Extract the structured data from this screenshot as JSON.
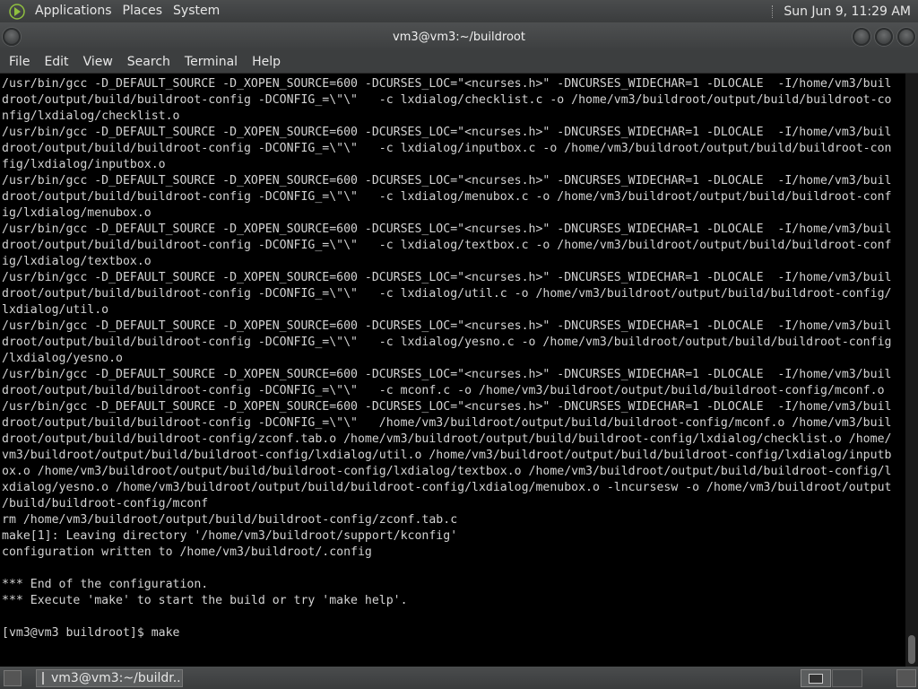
{
  "top_panel": {
    "menus": [
      "Applications",
      "Places",
      "System"
    ],
    "clock": "Sun Jun  9, 11:29 AM"
  },
  "window": {
    "title": "vm3@vm3:~/buildroot",
    "menu": [
      "File",
      "Edit",
      "View",
      "Search",
      "Terminal",
      "Help"
    ]
  },
  "terminal": {
    "lines": [
      "/usr/bin/gcc -D_DEFAULT_SOURCE -D_XOPEN_SOURCE=600 -DCURSES_LOC=\"<ncurses.h>\" -DNCURSES_WIDECHAR=1 -DLOCALE  -I/home/vm3/buil",
      "droot/output/build/buildroot-config -DCONFIG_=\\\"\\\"   -c lxdialog/checklist.c -o /home/vm3/buildroot/output/build/buildroot-co",
      "nfig/lxdialog/checklist.o",
      "/usr/bin/gcc -D_DEFAULT_SOURCE -D_XOPEN_SOURCE=600 -DCURSES_LOC=\"<ncurses.h>\" -DNCURSES_WIDECHAR=1 -DLOCALE  -I/home/vm3/buil",
      "droot/output/build/buildroot-config -DCONFIG_=\\\"\\\"   -c lxdialog/inputbox.c -o /home/vm3/buildroot/output/build/buildroot-con",
      "fig/lxdialog/inputbox.o",
      "/usr/bin/gcc -D_DEFAULT_SOURCE -D_XOPEN_SOURCE=600 -DCURSES_LOC=\"<ncurses.h>\" -DNCURSES_WIDECHAR=1 -DLOCALE  -I/home/vm3/buil",
      "droot/output/build/buildroot-config -DCONFIG_=\\\"\\\"   -c lxdialog/menubox.c -o /home/vm3/buildroot/output/build/buildroot-conf",
      "ig/lxdialog/menubox.o",
      "/usr/bin/gcc -D_DEFAULT_SOURCE -D_XOPEN_SOURCE=600 -DCURSES_LOC=\"<ncurses.h>\" -DNCURSES_WIDECHAR=1 -DLOCALE  -I/home/vm3/buil",
      "droot/output/build/buildroot-config -DCONFIG_=\\\"\\\"   -c lxdialog/textbox.c -o /home/vm3/buildroot/output/build/buildroot-conf",
      "ig/lxdialog/textbox.o",
      "/usr/bin/gcc -D_DEFAULT_SOURCE -D_XOPEN_SOURCE=600 -DCURSES_LOC=\"<ncurses.h>\" -DNCURSES_WIDECHAR=1 -DLOCALE  -I/home/vm3/buil",
      "droot/output/build/buildroot-config -DCONFIG_=\\\"\\\"   -c lxdialog/util.c -o /home/vm3/buildroot/output/build/buildroot-config/",
      "lxdialog/util.o",
      "/usr/bin/gcc -D_DEFAULT_SOURCE -D_XOPEN_SOURCE=600 -DCURSES_LOC=\"<ncurses.h>\" -DNCURSES_WIDECHAR=1 -DLOCALE  -I/home/vm3/buil",
      "droot/output/build/buildroot-config -DCONFIG_=\\\"\\\"   -c lxdialog/yesno.c -o /home/vm3/buildroot/output/build/buildroot-config",
      "/lxdialog/yesno.o",
      "/usr/bin/gcc -D_DEFAULT_SOURCE -D_XOPEN_SOURCE=600 -DCURSES_LOC=\"<ncurses.h>\" -DNCURSES_WIDECHAR=1 -DLOCALE  -I/home/vm3/buil",
      "droot/output/build/buildroot-config -DCONFIG_=\\\"\\\"   -c mconf.c -o /home/vm3/buildroot/output/build/buildroot-config/mconf.o",
      "/usr/bin/gcc -D_DEFAULT_SOURCE -D_XOPEN_SOURCE=600 -DCURSES_LOC=\"<ncurses.h>\" -DNCURSES_WIDECHAR=1 -DLOCALE  -I/home/vm3/buil",
      "droot/output/build/buildroot-config -DCONFIG_=\\\"\\\"   /home/vm3/buildroot/output/build/buildroot-config/mconf.o /home/vm3/buil",
      "droot/output/build/buildroot-config/zconf.tab.o /home/vm3/buildroot/output/build/buildroot-config/lxdialog/checklist.o /home/",
      "vm3/buildroot/output/build/buildroot-config/lxdialog/util.o /home/vm3/buildroot/output/build/buildroot-config/lxdialog/inputb",
      "ox.o /home/vm3/buildroot/output/build/buildroot-config/lxdialog/textbox.o /home/vm3/buildroot/output/build/buildroot-config/l",
      "xdialog/yesno.o /home/vm3/buildroot/output/build/buildroot-config/lxdialog/menubox.o -lncursesw -o /home/vm3/buildroot/output",
      "/build/buildroot-config/mconf",
      "rm /home/vm3/buildroot/output/build/buildroot-config/zconf.tab.c",
      "make[1]: Leaving directory '/home/vm3/buildroot/support/kconfig'",
      "configuration written to /home/vm3/buildroot/.config",
      "",
      "*** End of the configuration.",
      "*** Execute 'make' to start the build or try 'make help'.",
      "",
      "[vm3@vm3 buildroot]$ make"
    ]
  },
  "taskbar": {
    "task_label": "vm3@vm3:~/buildr..."
  }
}
